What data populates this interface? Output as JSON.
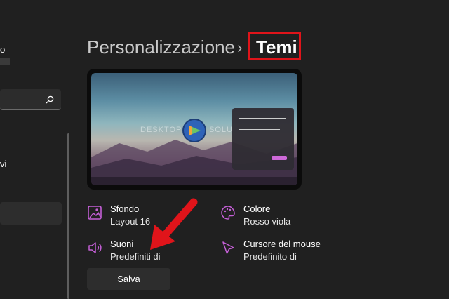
{
  "sidebar": {
    "user_name_fragment": "o",
    "nav_fragment": "vi"
  },
  "breadcrumb": {
    "parent": "Personalizzazione",
    "separator": "›",
    "current": "Temi"
  },
  "preview": {
    "watermark_left": "DESKTOP",
    "watermark_right": "SOLU"
  },
  "options": {
    "sfondo": {
      "title": "Sfondo",
      "value": "Layout 16",
      "icon": "image-icon"
    },
    "colore": {
      "title": "Colore",
      "value": "Rosso viola",
      "icon": "palette-icon"
    },
    "suoni": {
      "title": "Suoni",
      "value": "Predefiniti di",
      "icon": "speaker-icon"
    },
    "cursore": {
      "title": "Cursore del mouse",
      "value": "Predefinito di",
      "icon": "cursor-icon"
    }
  },
  "actions": {
    "save_label": "Salva"
  },
  "colors": {
    "background": "#202020",
    "accent": "#b146c2",
    "highlight_box": "#e0141a",
    "annotation_arrow": "#e0141a"
  }
}
